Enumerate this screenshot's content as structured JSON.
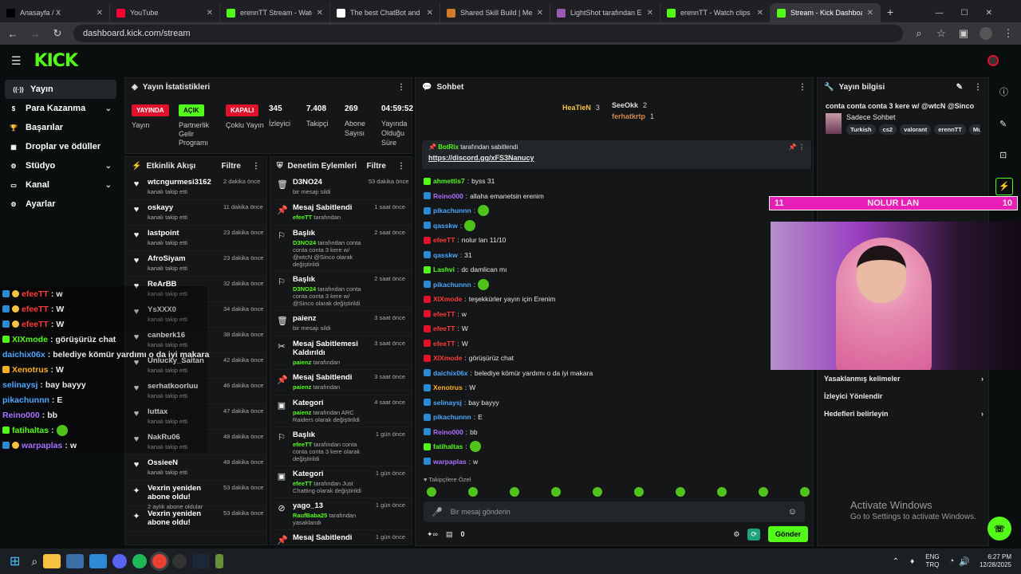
{
  "browser": {
    "tabs": [
      {
        "title": "Anasayfa / X",
        "color": "#000000"
      },
      {
        "title": "YouTube",
        "color": "#ff0033"
      },
      {
        "title": "erennTT Stream - Watch L",
        "color": "#53fc18"
      },
      {
        "title": "The best ChatBot and Wi",
        "color": "#ffffff"
      },
      {
        "title": "Shared Skill Build | MetaF",
        "color": "#d07a2a"
      },
      {
        "title": "LightShot tarafından Ekra",
        "color": "#9b59b6"
      },
      {
        "title": "erennTT - Watch clips on",
        "color": "#53fc18"
      },
      {
        "title": "Stream - Kick Dashboard",
        "color": "#53fc18"
      }
    ],
    "url": "dashboard.kick.com/stream"
  },
  "kick": {
    "logo": "KICK"
  },
  "sidebar": {
    "items": [
      {
        "label": "Yayın",
        "icon": "broadcast-icon",
        "chevron": false,
        "active": true
      },
      {
        "label": "Para Kazanma",
        "icon": "money-icon",
        "chevron": true
      },
      {
        "label": "Başarılar",
        "icon": "trophy-icon",
        "chevron": false
      },
      {
        "label": "Droplar ve ödüller",
        "icon": "gift-icon",
        "chevron": false
      },
      {
        "label": "Stüdyo",
        "icon": "studio-icon",
        "chevron": true
      },
      {
        "label": "Kanal",
        "icon": "channel-icon",
        "chevron": true
      },
      {
        "label": "Ayarlar",
        "icon": "settings-icon",
        "chevron": false
      }
    ]
  },
  "stats": {
    "title": "Yayın İstatistikleri",
    "badges": [
      {
        "text": "YAYINDA",
        "color": "#e0112b",
        "label": "Yayın"
      },
      {
        "text": "AÇIK",
        "color": "#53fc18",
        "label": "Partnerlik Gelir Programı"
      },
      {
        "text": "KAPALI",
        "color": "#e0112b",
        "label": "Çoklu Yayın"
      }
    ],
    "items": [
      {
        "value": "345",
        "label": "İzleyici"
      },
      {
        "value": "7.408",
        "label": "Takipçi"
      },
      {
        "value": "269",
        "label": "Abone Sayısı"
      },
      {
        "value": "04:59:52",
        "label": "Yayında Olduğu Süre"
      }
    ]
  },
  "activity": {
    "title": "Etkinlik Akışı",
    "filter": "Filtre",
    "rows": [
      {
        "name": "wtcngurmesi3162",
        "sub": "kanalı takip etti",
        "time": "2 dakika önce"
      },
      {
        "name": "oskayy",
        "sub": "kanalı takip etti",
        "time": "11 dakika önce"
      },
      {
        "name": "lastpoint",
        "sub": "kanalı takip etti",
        "time": "23 dakika önce"
      },
      {
        "name": "AfroSiyam",
        "sub": "kanalı takip etti",
        "time": "23 dakika önce"
      },
      {
        "name": "ReArBB",
        "sub": "kanalı takip etti",
        "time": "32 dakika önce"
      },
      {
        "name": "YsXXX0",
        "sub": "kanalı takip etti",
        "time": "34 dakika önce"
      },
      {
        "name": "canberk16",
        "sub": "kanalı takip etti",
        "time": "38 dakika önce"
      },
      {
        "name": "Unlucky_Saitan",
        "sub": "kanalı takip etti",
        "time": "42 dakika önce"
      },
      {
        "name": "serhatkoorluu",
        "sub": "kanalı takip etti",
        "time": "46 dakika önce"
      },
      {
        "name": "luttax",
        "sub": "kanalı takip etti",
        "time": "47 dakika önce"
      },
      {
        "name": "NakRu06",
        "sub": "kanalı takip etti",
        "time": "48 dakika önce"
      },
      {
        "name": "OssieeN",
        "sub": "kanalı takip etti",
        "time": "48 dakika önce"
      },
      {
        "name": "Vexrin yeniden abone oldu!",
        "sub": "2 aylık abone oldular",
        "time": "53 dakika önce",
        "star": true
      },
      {
        "name": "Vexrin yeniden abone oldu!",
        "sub": "",
        "time": "53 dakika önce",
        "star": true
      }
    ]
  },
  "moderation": {
    "title": "Denetim Eylemleri",
    "filter": "Filtre",
    "rows": [
      {
        "icon": "trash-icon",
        "name": "D3NO24",
        "sub": "bir mesajı sildi",
        "time": "53 dakika önce"
      },
      {
        "icon": "pin-icon",
        "name": "Mesaj Sabitlendi",
        "hl": "efeeTT",
        "sub": " tarafından",
        "time": "1 saat önce"
      },
      {
        "icon": "title-icon",
        "name": "Başlık",
        "hl": "D3NO24",
        "sub": " tarafından conta conta conta 3 kere w/ @wtcN @Sinco olarak değiştirildi",
        "time": "2 saat önce"
      },
      {
        "icon": "title-icon",
        "name": "Başlık",
        "hl": "D3NO24",
        "sub": " tarafından conta conta conta 3 kere w/ @Sinco olarak değiştirildi",
        "time": "2 saat önce"
      },
      {
        "icon": "trash-icon",
        "name": "paienz",
        "sub": "bir mesajı sildi",
        "time": "3 saat önce"
      },
      {
        "icon": "unpin-icon",
        "name": "Mesaj Sabitlemesi Kaldırıldı",
        "hl": "paienz",
        "sub": " tarafından",
        "time": "3 saat önce"
      },
      {
        "icon": "pin-icon",
        "name": "Mesaj Sabitlendi",
        "hl": "paienz",
        "sub": " tarafından",
        "time": "3 saat önce"
      },
      {
        "icon": "category-icon",
        "name": "Kategori",
        "hl": "paienz",
        "sub": " tarafından ARC Raiders olarak değiştirildi",
        "time": "4 saat önce"
      },
      {
        "icon": "title-icon",
        "name": "Başlık",
        "hl": "efeeTT",
        "sub": " tarafından conta conta conta 3 kere olarak değiştirildi",
        "time": "1 gün önce"
      },
      {
        "icon": "category-icon",
        "name": "Kategori",
        "hl": "efeeTT",
        "sub": " tarafından Just Chatting olarak değiştirildi",
        "time": "1 gün önce"
      },
      {
        "icon": "ban-icon",
        "name": "yago_13",
        "hl": "RaufBaba25",
        "sub": " tarafından yasaklandı",
        "time": "1 gün önce"
      },
      {
        "icon": "pin-icon",
        "name": "Mesaj Sabitlendi",
        "hl": "efeeTT",
        "sub": " tarafından",
        "time": "1 gün önce"
      }
    ]
  },
  "chat": {
    "title": "Sohbet",
    "top": [
      {
        "name": "HeaTieN",
        "count": "3"
      },
      {
        "name": "SeeOkk",
        "count": "2"
      },
      {
        "name": "ferhatkrtp",
        "count": "1"
      }
    ],
    "pinned": {
      "by": "BotRix",
      "text": " tarafından sabitlendi",
      "link": "https://discord.gg/xFS3Nanucy"
    },
    "messages": [
      {
        "user": "ahmettis7",
        "color": "#53fc18",
        "text": "byss 31"
      },
      {
        "user": "Reino000",
        "color": "#a970ff",
        "text": "allaha emanetsin erenim"
      },
      {
        "user": "pikachunnn",
        "color": "#4da6ff",
        "text": ""
      },
      {
        "user": "qasskw",
        "color": "#4da6ff",
        "text": ""
      },
      {
        "user": "efeeTT",
        "color": "#ff3b3b",
        "text": "nolur lan 11/10"
      },
      {
        "user": "qasskw",
        "color": "#4da6ff",
        "text": "31"
      },
      {
        "user": "Lashvi",
        "color": "#53fc18",
        "text": "dc damlican mı"
      },
      {
        "user": "pikachunnn",
        "color": "#4da6ff",
        "text": ""
      },
      {
        "user": "XIXmode",
        "color": "#ff3b3b",
        "text": "teşekkürler yayın için Erenim"
      },
      {
        "user": "efeeTT",
        "color": "#ff3b3b",
        "text": "w"
      },
      {
        "user": "efeeTT",
        "color": "#ff3b3b",
        "text": "W"
      },
      {
        "user": "efeeTT",
        "color": "#ff3b3b",
        "text": "W"
      },
      {
        "user": "XIXmode",
        "color": "#ff3b3b",
        "text": "görüşürüz chat"
      },
      {
        "user": "daichix06x",
        "color": "#4da6ff",
        "text": "belediye kömür yardımı o da iyi makara"
      },
      {
        "user": "Xenotrus",
        "color": "#ffb020",
        "text": "W"
      },
      {
        "user": "selinaysj",
        "color": "#4da6ff",
        "text": "bay bayyy"
      },
      {
        "user": "pikachunnn",
        "color": "#4da6ff",
        "text": "E"
      },
      {
        "user": "Reino000",
        "color": "#a970ff",
        "text": "bb"
      },
      {
        "user": "fatihaltas",
        "color": "#53fc18",
        "text": ""
      },
      {
        "user": "warpaplas",
        "color": "#a970ff",
        "text": "w"
      }
    ],
    "followers_only": "Takipçilere Özel",
    "placeholder": "Bir mesaj gönderin",
    "points": "0",
    "send": "Gönder"
  },
  "streaminfo": {
    "title": "Yayın bilgisi",
    "stream_title": "conta conta conta 3 kere w/ @wtcN @Sinco",
    "mode": "Sadece Sohbet",
    "tags": [
      "Turkish",
      "cs2",
      "valorant",
      "erennTT",
      "Mu"
    ],
    "menu": [
      {
        "label": "Yasaklanmış kelimeler",
        "chev": true
      },
      {
        "label": "İzleyici Yönlendir",
        "chev": false
      },
      {
        "label": "Hedefleri belirleyin",
        "chev": true
      }
    ]
  },
  "overlay_bar": {
    "left": "11",
    "center": "NOLUR LAN",
    "right": "10"
  },
  "overlay_chat": [
    {
      "user": "efeeTT",
      "color": "#ff3b3b",
      "text": "w"
    },
    {
      "user": "efeeTT",
      "color": "#ff3b3b",
      "text": "W"
    },
    {
      "user": "efeeTT",
      "color": "#ff3b3b",
      "text": "W"
    },
    {
      "user": "XIXmode",
      "color": "#53fc18",
      "text": "görüşürüz chat"
    },
    {
      "user": "daichix06x",
      "color": "#4da6ff",
      "text": "belediye kömür yardımı o da iyi makara"
    },
    {
      "user": "Xenotrus",
      "color": "#ffb020",
      "text": "W"
    },
    {
      "user": "selinaysj",
      "color": "#4da6ff",
      "text": "bay bayyy"
    },
    {
      "user": "pikachunnn",
      "color": "#4da6ff",
      "text": "E"
    },
    {
      "user": "Reino000",
      "color": "#a970ff",
      "text": "bb"
    },
    {
      "user": "fatihaltas",
      "color": "#53fc18",
      "text": ""
    },
    {
      "user": "warpaplas",
      "color": "#a970ff",
      "text": "w"
    }
  ],
  "watermark": {
    "line1": "Activate Windows",
    "line2": "Go to Settings to activate Windows."
  },
  "taskbar": {
    "lang": "ENG",
    "region": "TRQ",
    "time": "6:27 PM",
    "date": "12/28/2025"
  }
}
